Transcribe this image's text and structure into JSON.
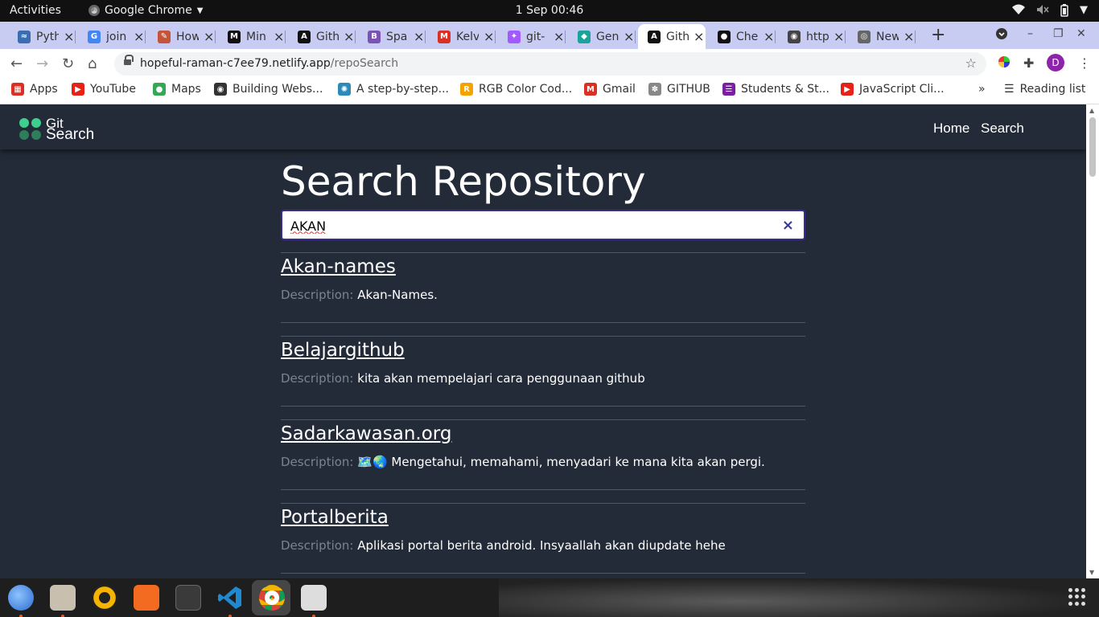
{
  "system": {
    "activities": "Activities",
    "app_name": "Google Chrome",
    "clock": "1 Sep  00:46"
  },
  "tabs": [
    {
      "label": "Pyth",
      "icon": "python-tab-icon",
      "color": "#3b6db3"
    },
    {
      "label": "join",
      "icon": "google-tab-icon",
      "color": "#4285f4"
    },
    {
      "label": "How",
      "icon": "html-tab-icon",
      "color": "#c4543a"
    },
    {
      "label": "Min",
      "icon": "moringa-tab-icon",
      "color": "#111111"
    },
    {
      "label": "Gith",
      "icon": "angular-tab-icon",
      "color": "#111111"
    },
    {
      "label": "Spa",
      "icon": "bootstrap-tab-icon",
      "color": "#7952b3"
    },
    {
      "label": "Kelv",
      "icon": "gmail-tab-icon",
      "color": "#d93025"
    },
    {
      "label": "git-",
      "icon": "figma-tab-icon",
      "color": "#a259ff"
    },
    {
      "label": "Gen",
      "icon": "diamond-tab-icon",
      "color": "#1aa39a"
    },
    {
      "label": "Gith",
      "icon": "angular-tab-icon",
      "color": "#111111",
      "active": true
    },
    {
      "label": "Che",
      "icon": "github-tab-icon",
      "color": "#111111"
    },
    {
      "label": "http",
      "icon": "globe-tab-icon",
      "color": "#444444"
    },
    {
      "label": "New",
      "icon": "chrome-tab-icon",
      "color": "#666666"
    }
  ],
  "address": {
    "host": "hopeful-raman-c7ee79.netlify.app",
    "path": "/repoSearch"
  },
  "bookmarks": [
    {
      "label": "Apps",
      "icon": "apps-grid-icon",
      "color": "#d93025"
    },
    {
      "label": "YouTube",
      "icon": "youtube-icon",
      "color": "#e62117"
    },
    {
      "label": "Maps",
      "icon": "maps-pin-icon",
      "color": "#34a853"
    },
    {
      "label": "Building Webs...",
      "icon": "globe-icon",
      "color": "#333333"
    },
    {
      "label": "A step-by-step...",
      "icon": "bookmark-site-icon",
      "color": "#2b8ab8"
    },
    {
      "label": "RGB Color Cod...",
      "icon": "rgb-site-icon",
      "color": "#f4a300"
    },
    {
      "label": "Gmail",
      "icon": "gmail-icon",
      "color": "#d93025"
    },
    {
      "label": "GITHUB",
      "icon": "github-tree-icon",
      "color": "#888888"
    },
    {
      "label": "Students & St...",
      "icon": "students-site-icon",
      "color": "#7b1fa2"
    },
    {
      "label": "JavaScript Cli...",
      "icon": "youtube-icon",
      "color": "#e62117"
    }
  ],
  "reading_list": "Reading list",
  "overflow": "»",
  "site": {
    "logo_line1": "Git",
    "logo_line2": "Search",
    "nav": [
      "Home",
      "Search"
    ],
    "heading": "Search Repository",
    "search_value": "AKAN",
    "clear": "×",
    "desc_label": "Description:",
    "results": [
      {
        "name": "Akan-names",
        "description": "Akan-Names."
      },
      {
        "name": "Belajargithub",
        "description": "kita akan mempelajari cara penggunaan github"
      },
      {
        "name": "Sadarkawasan.org",
        "description": "🗺️🌏 Mengetahui, memahami, menyadari ke mana kita akan pergi."
      },
      {
        "name": "Portalberita",
        "description": "Aplikasi portal berita android. Insyaallah akan diupdate hehe"
      }
    ]
  },
  "colors": {
    "page_bg": "#232b38",
    "logo_green": "#3ecf8e",
    "logo_dark_green": "#2e7d5b",
    "search_border": "#3a2d8f"
  },
  "dock": [
    "thunderbird-icon",
    "files-icon",
    "rhythmbox-icon",
    "software-center-icon",
    "terminal-icon",
    "vscode-icon",
    "chrome-icon",
    "screenshot-icon"
  ]
}
